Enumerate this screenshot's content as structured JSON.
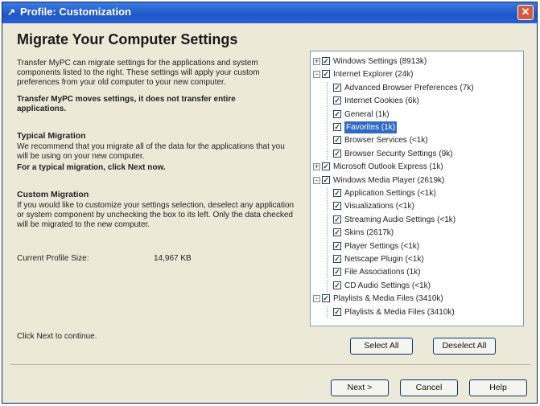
{
  "window": {
    "title": "Profile: Customization",
    "close_label": "✕"
  },
  "main": {
    "heading": "Migrate Your Computer Settings",
    "intro": "Transfer MyPC can migrate settings for the applications and system components listed to the right.  These settings will apply your custom preferences from your old computer to your new computer.",
    "note": "Transfer MyPC moves settings, it does not transfer entire applications.",
    "typical_title": "Typical Migration",
    "typical_text": "We recommend that you migrate all of the data for the applications that you will be using on your new computer.",
    "typical_hint": "For a typical migration, click Next now.",
    "custom_title": "Custom Migration",
    "custom_text": "If you would like to customize your settings selection, deselect any application or system component by unchecking the box to its left. Only the data checked will be migrated to the new computer.",
    "profile_size_label": "Current Profile Size:",
    "profile_size_value": "14,967 KB",
    "continue_hint": "Click Next to continue."
  },
  "tree": {
    "items": [
      {
        "label": "Windows Settings (8913k)",
        "level": 0,
        "checked": true,
        "expander": "+"
      },
      {
        "label": "Internet Explorer (24k)",
        "level": 0,
        "checked": true,
        "expander": "-"
      },
      {
        "label": "Advanced Browser Preferences (7k)",
        "level": 1,
        "checked": true
      },
      {
        "label": "Internet Cookies (6k)",
        "level": 1,
        "checked": true
      },
      {
        "label": "General (1k)",
        "level": 1,
        "checked": true
      },
      {
        "label": "Favorites (1k)",
        "level": 1,
        "checked": true,
        "selected": true
      },
      {
        "label": "Browser Services (<1k)",
        "level": 1,
        "checked": true
      },
      {
        "label": "Browser Security Settings (9k)",
        "level": 1,
        "checked": true
      },
      {
        "label": "Microsoft Outlook Express (1k)",
        "level": 0,
        "checked": true,
        "expander": "+"
      },
      {
        "label": "Windows Media Player (2619k)",
        "level": 0,
        "checked": true,
        "expander": "-"
      },
      {
        "label": "Application Settings (<1k)",
        "level": 1,
        "checked": true
      },
      {
        "label": "Visualizations (<1k)",
        "level": 1,
        "checked": true
      },
      {
        "label": "Streaming Audio Settings (<1k)",
        "level": 1,
        "checked": true
      },
      {
        "label": "Skins (2617k)",
        "level": 1,
        "checked": true
      },
      {
        "label": "Player Settings (<1k)",
        "level": 1,
        "checked": true
      },
      {
        "label": "Netscape Plugin (<1k)",
        "level": 1,
        "checked": true
      },
      {
        "label": "File Associations (1k)",
        "level": 1,
        "checked": true
      },
      {
        "label": "CD Audio Settings (<1k)",
        "level": 1,
        "checked": true
      },
      {
        "label": "Playlists & Media Files (3410k)",
        "level": 0,
        "checked": true,
        "expander": "-"
      },
      {
        "label": "Playlists & Media Files (3410k)",
        "level": 1,
        "checked": true
      }
    ]
  },
  "buttons": {
    "select_all": "Select All",
    "deselect_all": "Deselect All",
    "next": "Next >",
    "cancel": "Cancel",
    "help": "Help"
  }
}
